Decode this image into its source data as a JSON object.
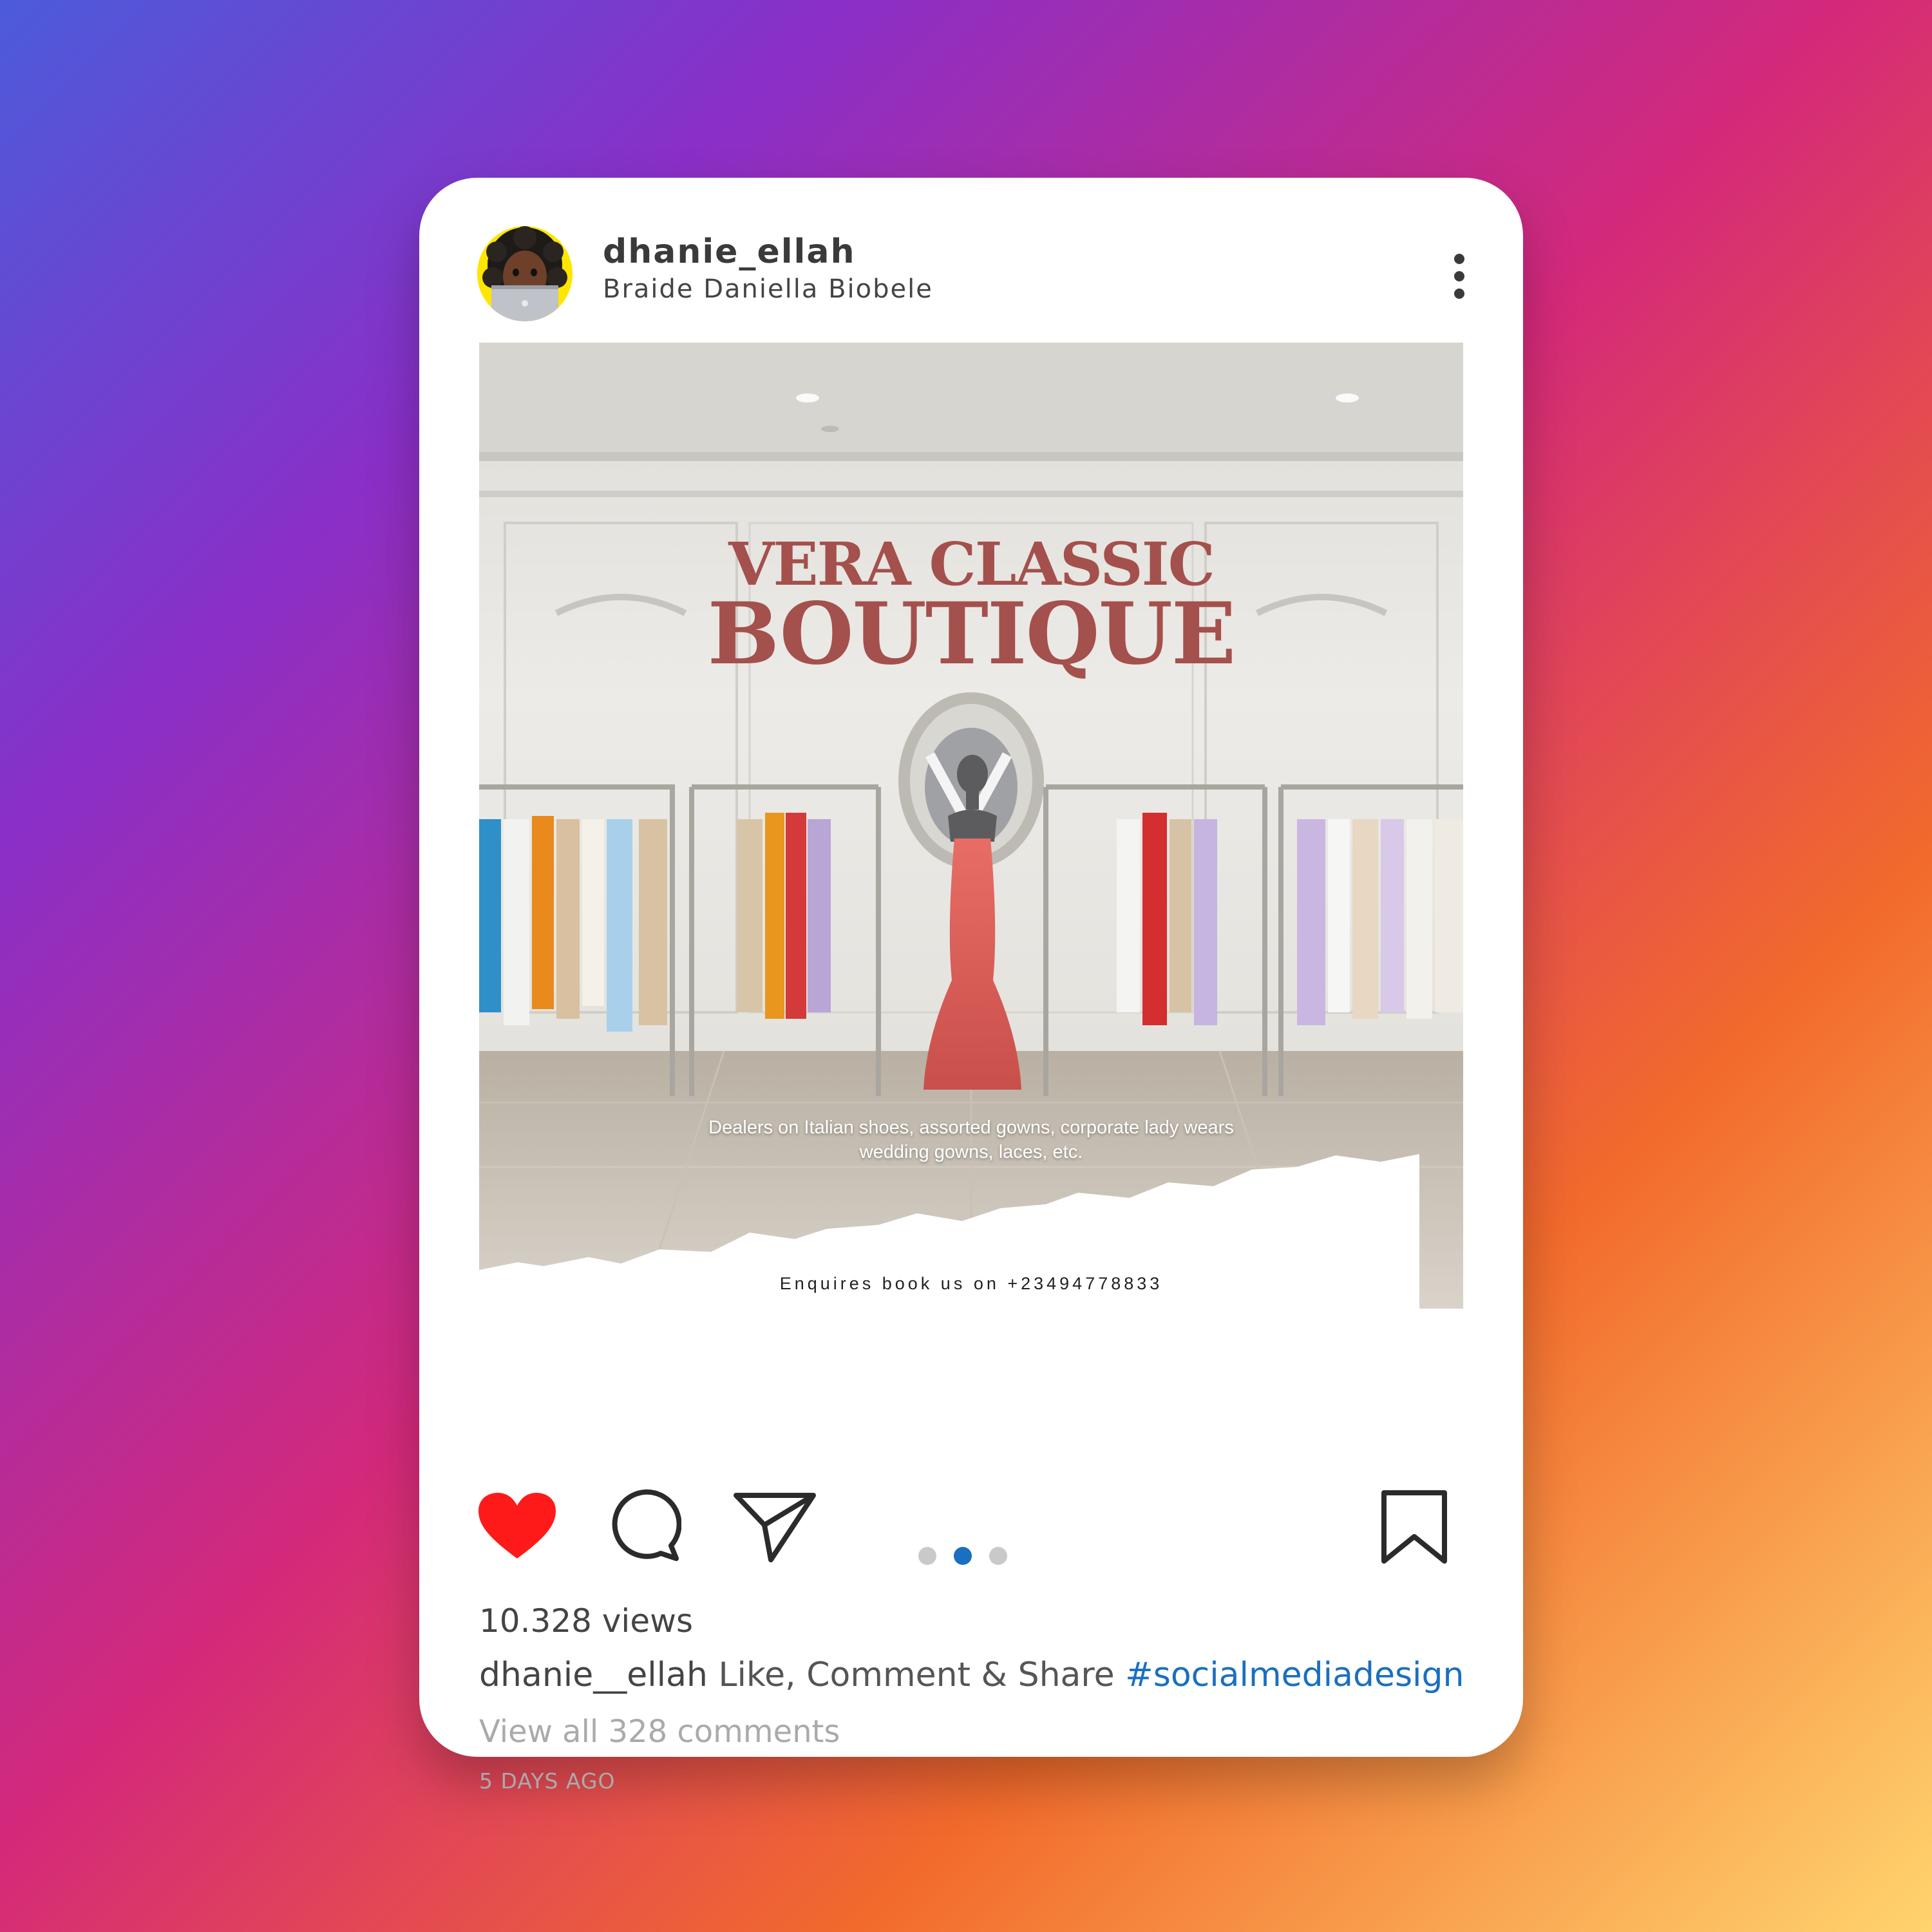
{
  "colors": {
    "like_red": "#ff1a1a",
    "active_dot": "#1a6fc0",
    "inactive_dot": "#c9c9c9",
    "hashtag_blue": "#1a6fc0",
    "title_rose": "#a4504d",
    "avatar_ring": "#ffe600"
  },
  "header": {
    "username": "dhanie_ellah",
    "full_name": "Braide Daniella Biobele",
    "avatar_icon": "memoji-avatar-icon",
    "menu_icon": "more-vertical-icon"
  },
  "post": {
    "title_line1": "VERA CLASSIC",
    "title_line2": "BOUTIQUE",
    "tagline_line1": "Dealers on Italian shoes, assorted gowns, corporate lady wears",
    "tagline_line2": "wedding gowns, laces, etc.",
    "contact": "Enquires book us on +23494778833"
  },
  "actions": {
    "like_icon": "heart-filled-icon",
    "comment_icon": "comment-bubble-icon",
    "share_icon": "paper-plane-icon",
    "save_icon": "bookmark-icon",
    "carousel_index": 2,
    "carousel_total": 3
  },
  "stats": {
    "views": "10.328 views"
  },
  "caption": {
    "username": "dhanie__ellah",
    "text": "Like, Comment & Share",
    "hashtag": "#socialmediadesign"
  },
  "comments": {
    "link_text": "View all 328 comments"
  },
  "timestamp": "5 DAYS AGO"
}
